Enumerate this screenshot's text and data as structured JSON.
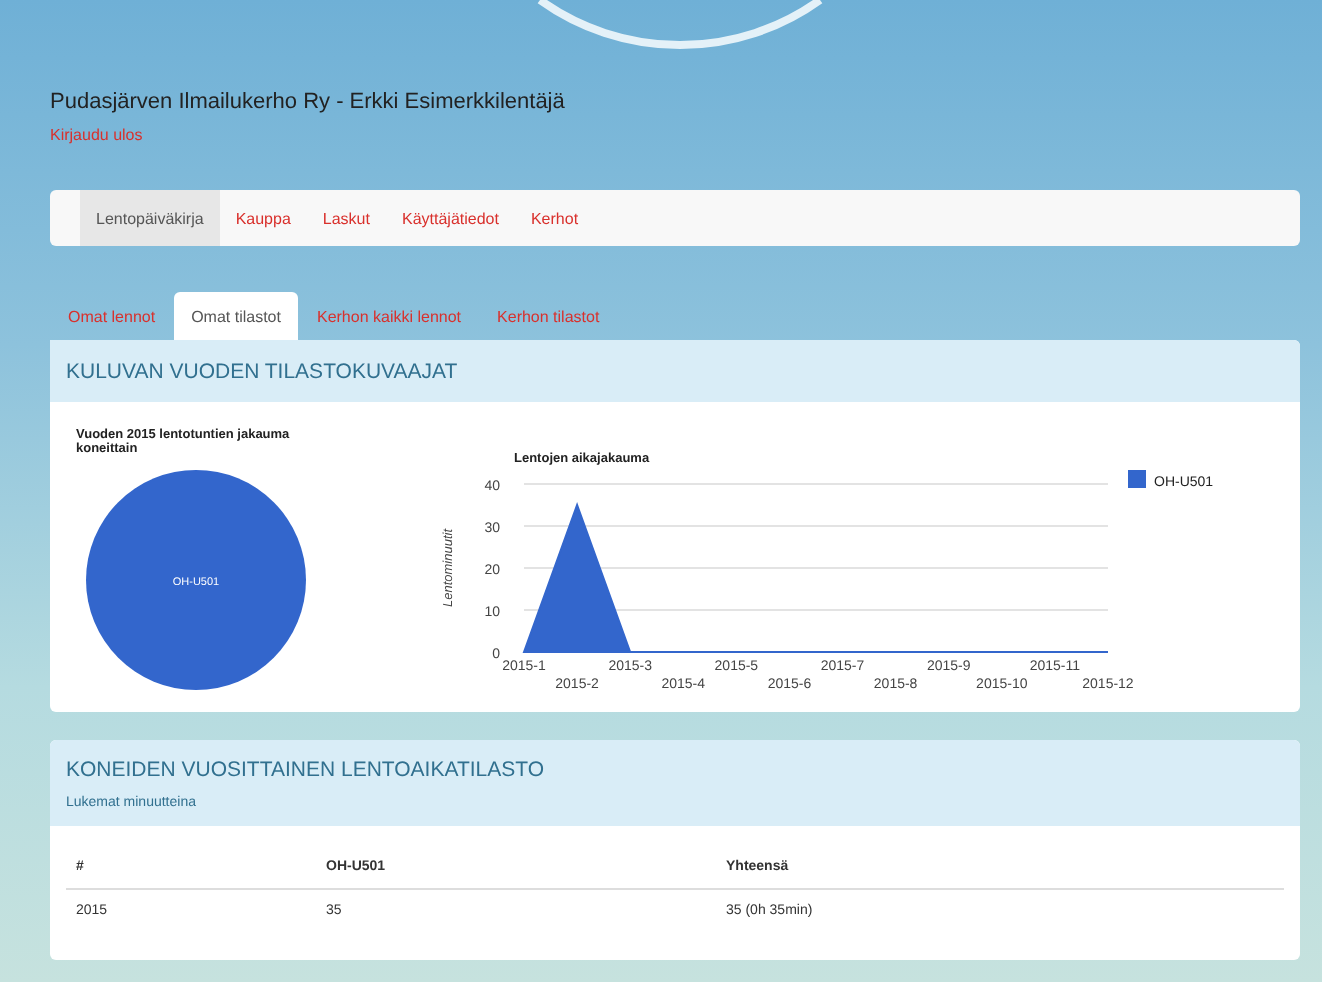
{
  "header": {
    "title": "Pudasjärven Ilmailukerho Ry - Erkki Esimerkkilentäjä",
    "logout_link": "Kirjaudu ulos"
  },
  "navbar": {
    "items": [
      {
        "label": "Lentopäiväkirja",
        "selected": true
      },
      {
        "label": "Kauppa",
        "selected": false
      },
      {
        "label": "Laskut",
        "selected": false
      },
      {
        "label": "Käyttäjätiedot",
        "selected": false
      },
      {
        "label": "Kerhot",
        "selected": false
      }
    ]
  },
  "tabs": [
    {
      "label": "Omat lennot",
      "selected": false
    },
    {
      "label": "Omat tilastot",
      "selected": true
    },
    {
      "label": "Kerhon kaikki lennot",
      "selected": false
    },
    {
      "label": "Kerhon tilastot",
      "selected": false
    }
  ],
  "charts_panel": {
    "title": "KULUVAN VUODEN TILASTOKUVAAJAT",
    "pie": {
      "title": "Vuoden 2015 lentotuntien jakauma koneittain",
      "slices": [
        {
          "label": "OH-U501",
          "color": "#3366cc"
        }
      ]
    },
    "area": {
      "chart_data": {
        "type": "area",
        "title": "Lentojen aikajakauma",
        "ylabel": "Lentominuutit",
        "categories": [
          "2015-1",
          "2015-2",
          "2015-3",
          "2015-4",
          "2015-5",
          "2015-6",
          "2015-7",
          "2015-8",
          "2015-9",
          "2015-10",
          "2015-11",
          "2015-12"
        ],
        "series": [
          {
            "name": "OH-U501",
            "color": "#3366cc",
            "values": [
              0,
              35,
              0,
              0,
              0,
              0,
              0,
              0,
              0,
              0,
              0,
              0
            ]
          }
        ],
        "ylim": [
          0,
          40
        ],
        "yticks": [
          0,
          10,
          20,
          30,
          40
        ],
        "grid": true
      }
    }
  },
  "stats_panel": {
    "title": "KONEIDEN VUOSITTAINEN LENTOAIKATILASTO",
    "subtitle": "Lukemat minuutteina",
    "table": {
      "columns": [
        "#",
        "OH-U501",
        "Yhteensä"
      ],
      "rows": [
        [
          "2015",
          "35",
          "35 (0h 35min)"
        ]
      ]
    }
  }
}
